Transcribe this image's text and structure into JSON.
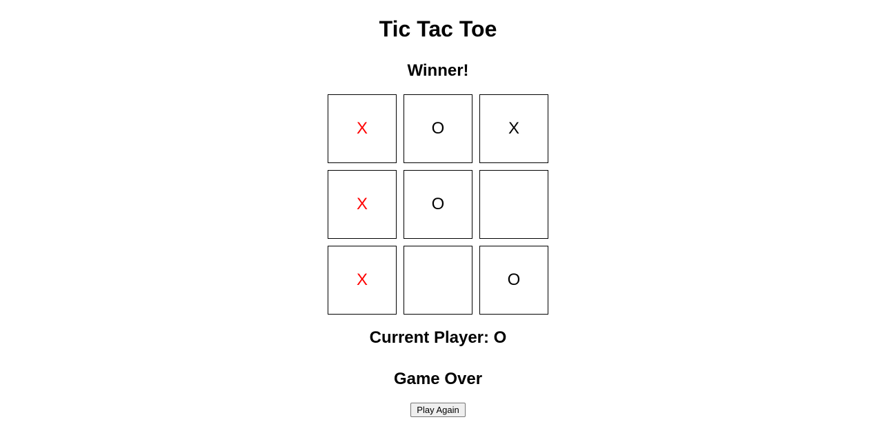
{
  "title": "Tic Tac Toe",
  "status_heading": "Winner!",
  "board": {
    "cells": [
      {
        "value": "X",
        "win": true
      },
      {
        "value": "O",
        "win": false
      },
      {
        "value": "X",
        "win": false
      },
      {
        "value": "X",
        "win": true
      },
      {
        "value": "O",
        "win": false
      },
      {
        "value": "",
        "win": false
      },
      {
        "value": "X",
        "win": true
      },
      {
        "value": "",
        "win": false
      },
      {
        "value": "O",
        "win": false
      }
    ]
  },
  "current_player_label": "Current Player: O",
  "game_over_label": "Game Over",
  "play_again_label": "Play Again"
}
